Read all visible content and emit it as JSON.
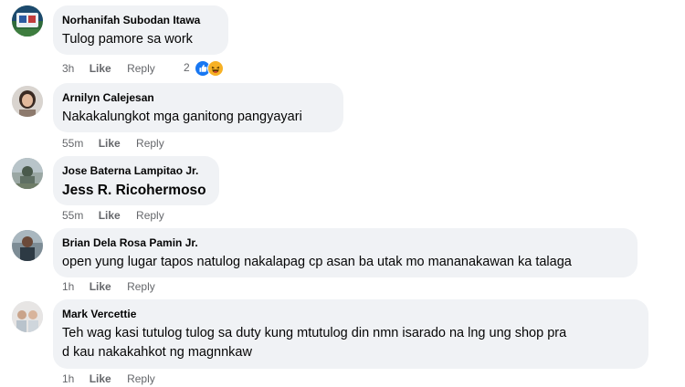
{
  "colors": {
    "bubble_bg": "#f0f2f5",
    "meta_text": "#65676b",
    "like_blue": "#1877f2",
    "haha_yellow": "#f7b125"
  },
  "comments": [
    {
      "author": "Norhanifah Subodan Itawa",
      "text": "Tulog pamore sa work",
      "time": "3h",
      "like_label": "Like",
      "reply_label": "Reply",
      "reaction_count": "2",
      "reaction_icons": [
        "like-icon",
        "haha-icon"
      ]
    },
    {
      "author": "Arnilyn Calejesan",
      "text": "Nakakalungkot mga ganitong pangyayari",
      "time": "55m",
      "like_label": "Like",
      "reply_label": "Reply"
    },
    {
      "author": "Jose Baterna Lampitao Jr.",
      "text": "Jess R. Ricohermoso",
      "time": "55m",
      "like_label": "Like",
      "reply_label": "Reply"
    },
    {
      "author": "Brian Dela Rosa Pamin Jr.",
      "text": "open yung lugar tapos natulog nakalapag cp asan ba utak mo mananakawan ka talaga",
      "time": "1h",
      "like_label": "Like",
      "reply_label": "Reply"
    },
    {
      "author": "Mark Vercettie",
      "text_line1": "Teh wag kasi tutulog tulog sa duty kung mtutulog din nmn isarado na lng ung shop pra",
      "text_line2": "d kau nakakahkot ng magnnkaw",
      "time": "1h",
      "like_label": "Like",
      "reply_label": "Reply"
    }
  ]
}
